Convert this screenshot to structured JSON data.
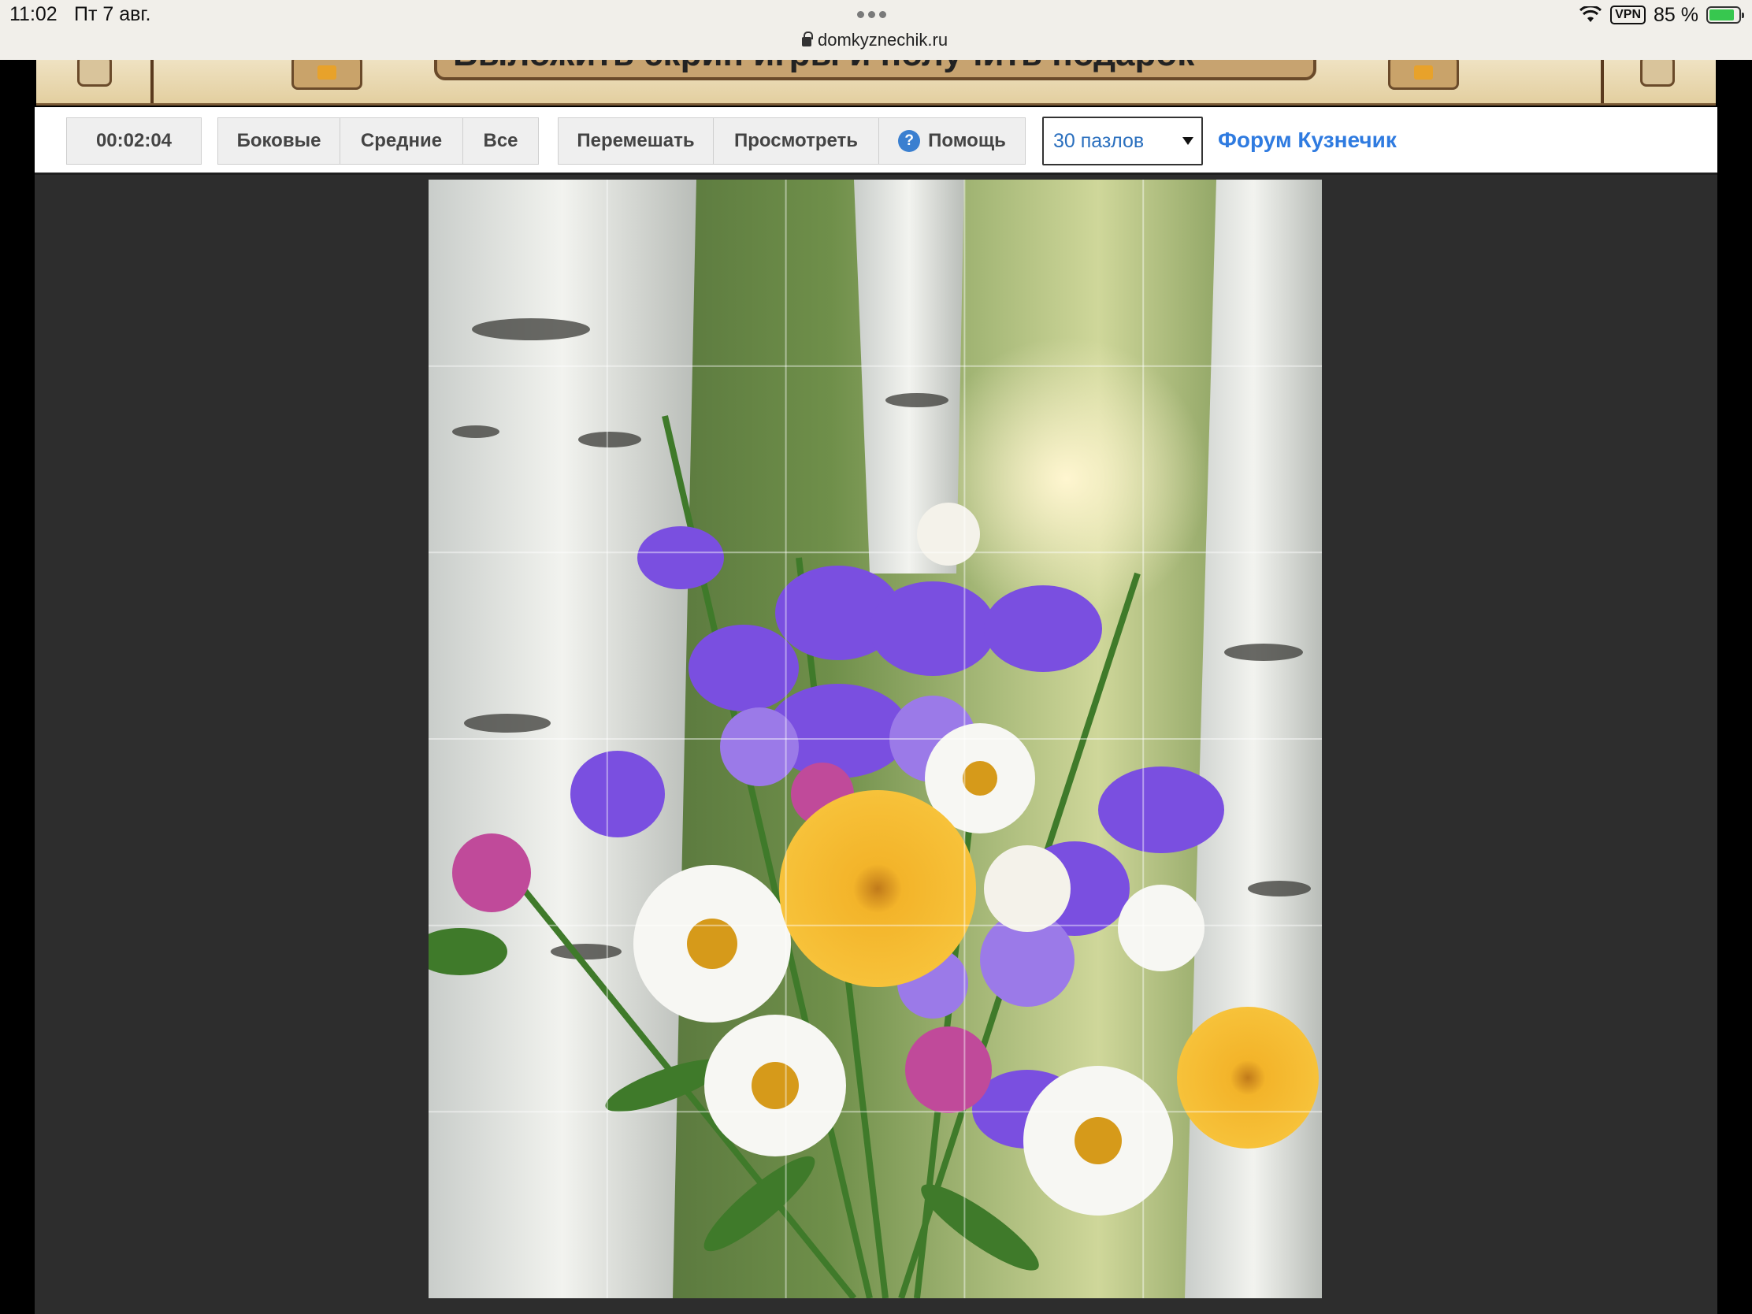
{
  "status_bar": {
    "time": "11:02",
    "date": "Пт 7 авг.",
    "url": "domkyznechik.ru",
    "vpn": "VPN",
    "battery": "85 %",
    "battery_level": 0.85
  },
  "banner": {
    "promo_text": "Выложить скрин игры и получить подарок"
  },
  "toolbar": {
    "timer": "00:02:04",
    "filter_buttons": [
      "Боковые",
      "Средние",
      "Все"
    ],
    "shuffle": "Перемешать",
    "preview": "Просмотреть",
    "help": "Помощь",
    "help_icon_glyph": "?",
    "pieces_select": "30 пазлов",
    "forum_link": "Форум Кузнечик"
  },
  "puzzle": {
    "columns": 5,
    "rows": 6
  },
  "colors": {
    "link": "#2f7be0",
    "frame_bg": "#2d2d2d",
    "help_icon": "#3a7fd0"
  }
}
